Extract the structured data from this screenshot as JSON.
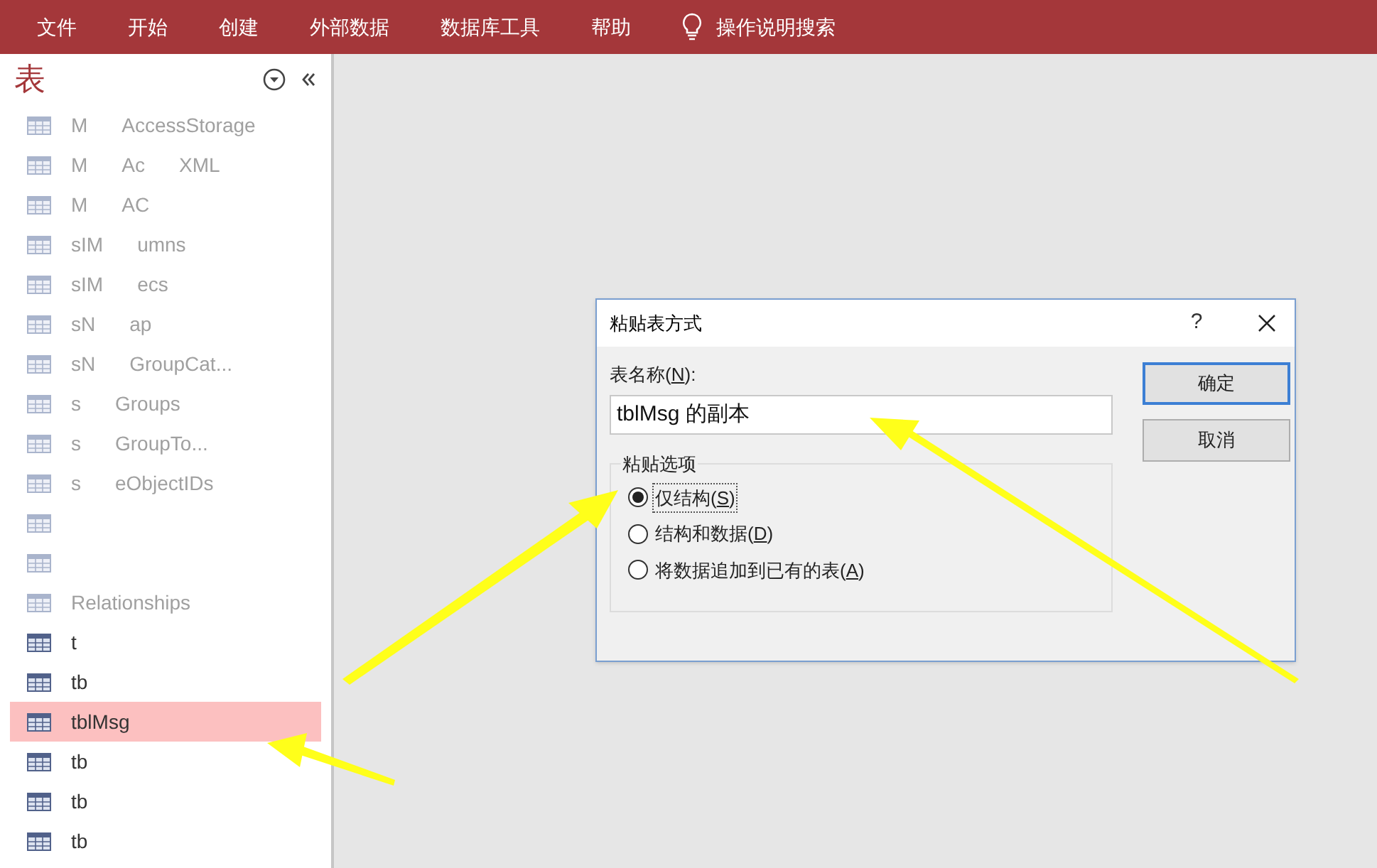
{
  "menu": [
    {
      "label": "文件"
    },
    {
      "label": "开始"
    },
    {
      "label": "创建"
    },
    {
      "label": "外部数据"
    },
    {
      "label": "数据库工具"
    },
    {
      "label": "帮助"
    },
    {
      "label": "操作说明搜索",
      "kind": "search"
    }
  ],
  "sidebar": {
    "title": "表",
    "items": [
      {
        "fragments": [
          "M",
          "AccessStorage"
        ],
        "dimmed": true,
        "selected": false
      },
      {
        "fragments": [
          "M",
          "Ac",
          "XML"
        ],
        "dimmed": true,
        "selected": false
      },
      {
        "fragments": [
          "M",
          "AC"
        ],
        "dimmed": true,
        "selected": false
      },
      {
        "fragments": [
          "sIM",
          "umns"
        ],
        "dimmed": true,
        "selected": false
      },
      {
        "fragments": [
          "sIM",
          "ecs"
        ],
        "dimmed": true,
        "selected": false
      },
      {
        "fragments": [
          "sN",
          "ap"
        ],
        "dimmed": true,
        "selected": false
      },
      {
        "fragments": [
          "sN",
          "GroupCat..."
        ],
        "dimmed": true,
        "selected": false
      },
      {
        "fragments": [
          "s",
          "Groups"
        ],
        "dimmed": true,
        "selected": false
      },
      {
        "fragments": [
          "s",
          "GroupTo..."
        ],
        "dimmed": true,
        "selected": false
      },
      {
        "fragments": [
          "s",
          "eObjectIDs"
        ],
        "dimmed": true,
        "selected": false
      },
      {
        "dimmed": true,
        "selected": false
      },
      {
        "dimmed": true,
        "selected": false
      },
      {
        "fragments": [
          "Relationships"
        ],
        "dimmed": true,
        "selected": false
      },
      {
        "fragments": [
          "t"
        ],
        "dimmed": false,
        "selected": false
      },
      {
        "fragments": [
          "tb"
        ],
        "dimmed": false,
        "selected": false
      },
      {
        "fragments": [
          "tblMsg"
        ],
        "dimmed": false,
        "selected": true
      },
      {
        "fragments": [
          "tb"
        ],
        "dimmed": false,
        "selected": false
      },
      {
        "fragments": [
          "tb"
        ],
        "dimmed": false,
        "selected": false
      },
      {
        "fragments": [
          "tb"
        ],
        "dimmed": false,
        "selected": false
      }
    ]
  },
  "dialog": {
    "title": "粘贴表方式",
    "help": "?",
    "name_label": {
      "before": "表名称(",
      "key": "N",
      "after": "):"
    },
    "name_value": "tblMsg 的副本",
    "group_title": "粘贴选项",
    "options": [
      {
        "before": "仅结构(",
        "key": "S",
        "after": ")",
        "selected": true
      },
      {
        "before": "结构和数据(",
        "key": "D",
        "after": ")",
        "selected": false
      },
      {
        "before": "将数据追加到已有的表(",
        "key": "A",
        "after": ")",
        "selected": false
      }
    ],
    "buttons": [
      {
        "label": "确定",
        "default": true
      },
      {
        "label": "取消",
        "default": false
      }
    ]
  }
}
